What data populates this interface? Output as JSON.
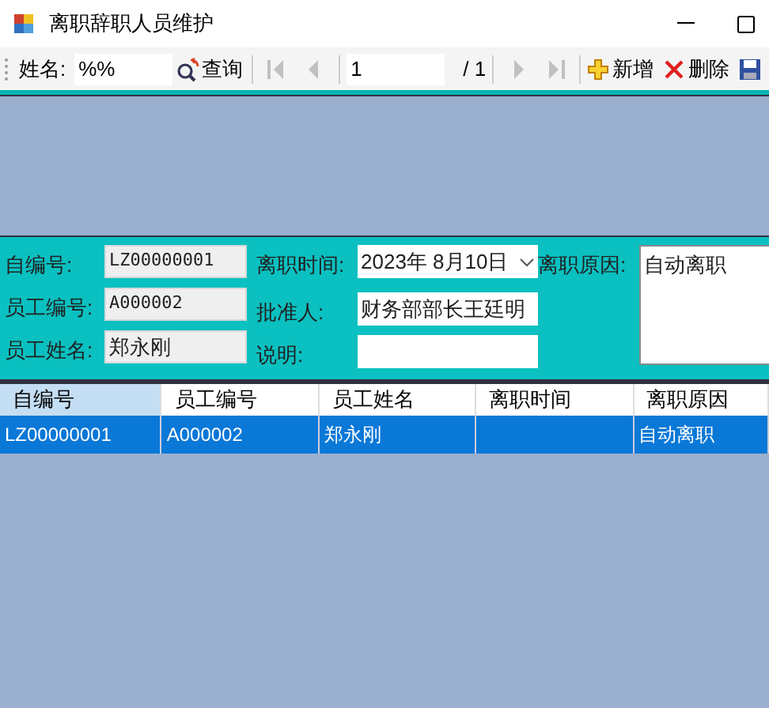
{
  "window": {
    "title": "离职辞职人员维护"
  },
  "toolbar": {
    "name_label": "姓名:",
    "name_value": "%%",
    "query_button": "查询",
    "page_value": "1",
    "page_total": "/ 1",
    "nav": [
      {
        "kind": "first",
        "disabled": true
      },
      {
        "kind": "prev",
        "disabled": true
      },
      {
        "kind": "next",
        "disabled": true
      },
      {
        "kind": "last",
        "disabled": true
      }
    ],
    "add_button": "新增",
    "delete_button": "删除"
  },
  "form": {
    "fields": [
      {
        "label": "自编号:",
        "value": "LZ00000001",
        "readonly": true
      },
      {
        "label": "员工编号:",
        "value": "A000002",
        "readonly": true
      },
      {
        "label": "员工姓名:",
        "value": "郑永刚",
        "readonly": true
      },
      {
        "label": "离职时间:",
        "value": "2023年  8月10日",
        "kind": "date"
      },
      {
        "label": "批准人:",
        "value": "财务部部长王廷明"
      },
      {
        "label": "说明:"
      },
      {
        "label": "离职原因:",
        "value": "自动离职",
        "kind": "memo"
      }
    ]
  },
  "table": {
    "columns": [
      {
        "label": "自编号",
        "selected": true
      },
      {
        "label": "员工编号",
        "selected": false
      },
      {
        "label": "员工姓名",
        "selected": false
      },
      {
        "label": "离职时间",
        "selected": false
      },
      {
        "label": "离职原因",
        "selected": false
      }
    ],
    "rows": [
      {
        "selected": true,
        "cells": [
          "LZ00000001",
          "A000002",
          "郑永刚",
          null,
          "自动离职"
        ]
      }
    ]
  }
}
